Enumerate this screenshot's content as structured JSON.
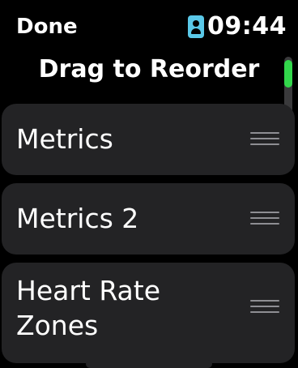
{
  "status_bar": {
    "done_label": "Done",
    "time": "09:44",
    "badge_icon": "person-badge-icon",
    "badge_color": "#5ac8e8"
  },
  "page": {
    "title": "Drag to Reorder"
  },
  "scroll": {
    "thumb_color": "#32d74b"
  },
  "items": [
    {
      "label": "Metrics",
      "handle_icon": "drag-handle-icon"
    },
    {
      "label": "Metrics 2",
      "handle_icon": "drag-handle-icon"
    },
    {
      "label": "Heart Rate Zones",
      "label_line1": "Heart Rate",
      "label_line2": "Zones",
      "handle_icon": "drag-handle-icon"
    }
  ]
}
